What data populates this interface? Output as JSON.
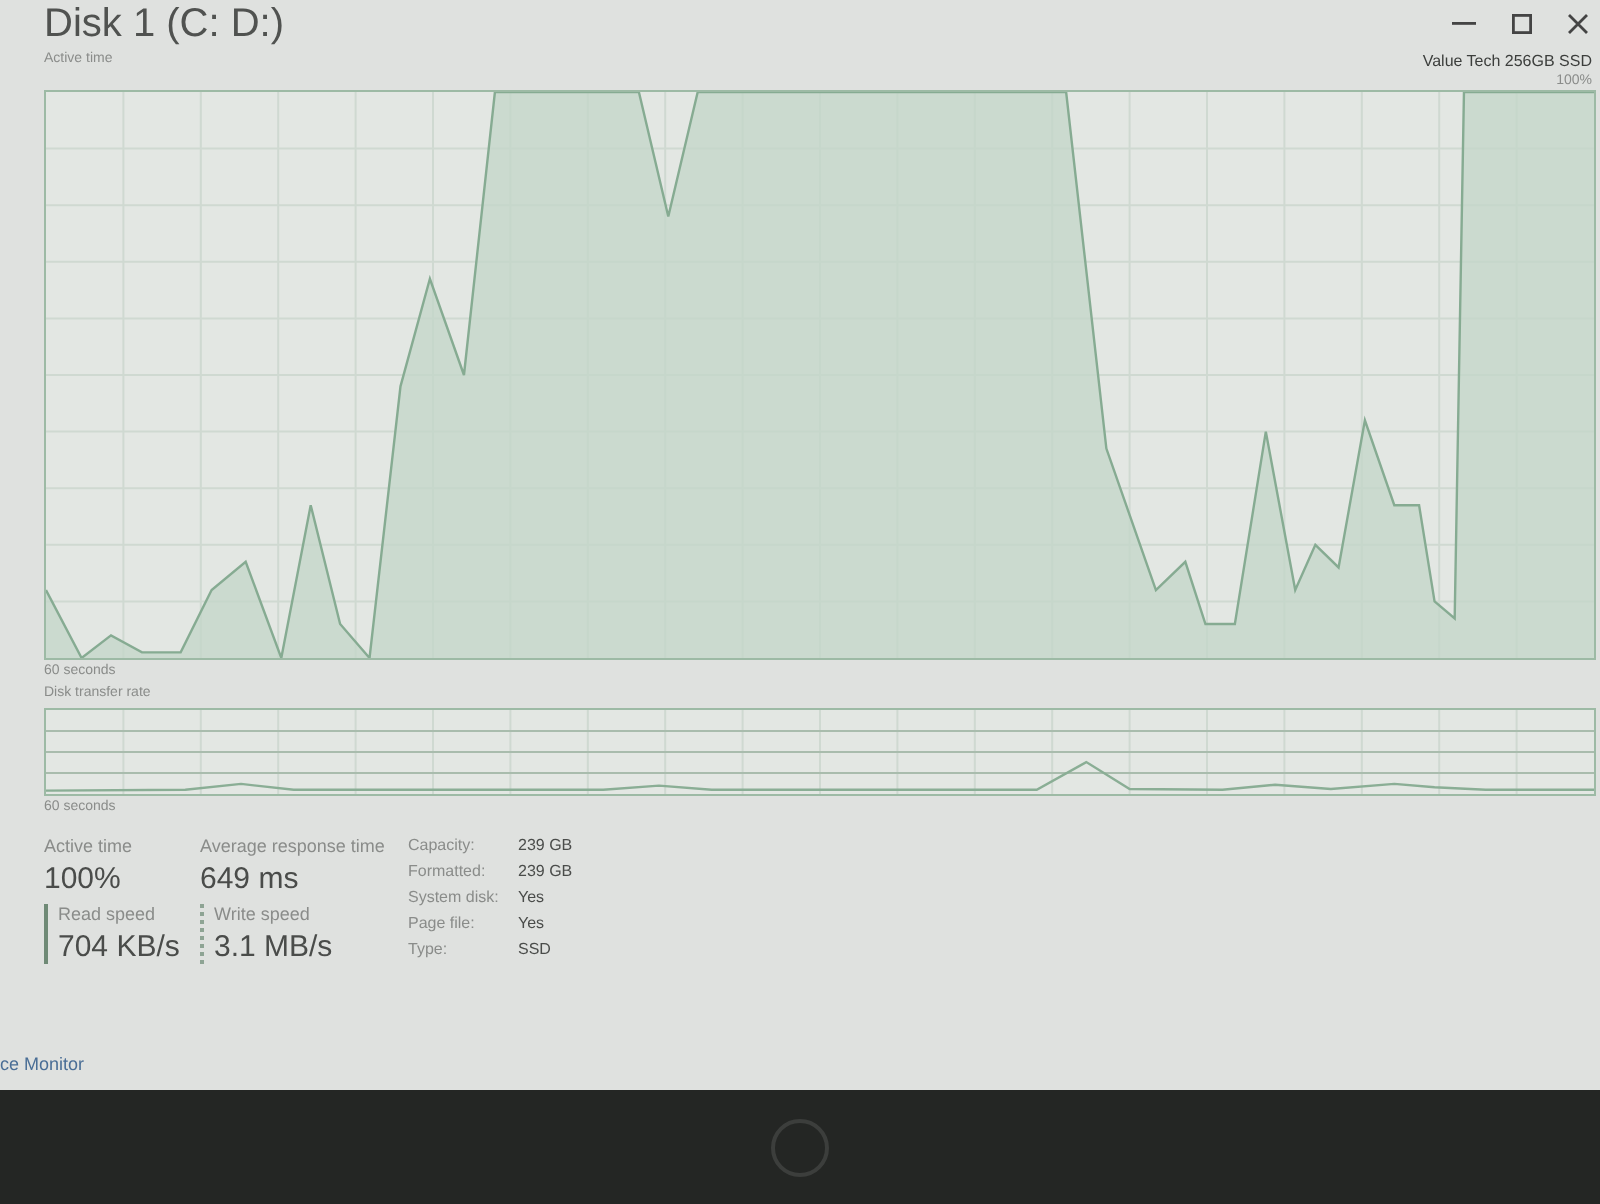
{
  "window": {
    "title": "Disk 1 (C: D:)",
    "model": "Value Tech 256GB SSD"
  },
  "active_time_chart": {
    "label": "Active time",
    "max_label": "100%",
    "time_span": "60 seconds"
  },
  "transfer_chart": {
    "label": "Disk transfer rate",
    "time_span": "60 seconds"
  },
  "stats": [
    {
      "label": "Active time",
      "value": "100%",
      "kind": "plain"
    },
    {
      "label": "Average response time",
      "value": "649 ms",
      "kind": "plain"
    },
    {
      "label": "Read speed",
      "value": "704 KB/s",
      "kind": "solid"
    },
    {
      "label": "Write speed",
      "value": "3.1 MB/s",
      "kind": "dotted"
    }
  ],
  "properties": [
    {
      "label": "Capacity:",
      "value": "239 GB"
    },
    {
      "label": "Formatted:",
      "value": "239 GB"
    },
    {
      "label": "System disk:",
      "value": "Yes"
    },
    {
      "label": "Page file:",
      "value": "Yes"
    },
    {
      "label": "Type:",
      "value": "SSD"
    }
  ],
  "footer_link": "ce Monitor"
}
